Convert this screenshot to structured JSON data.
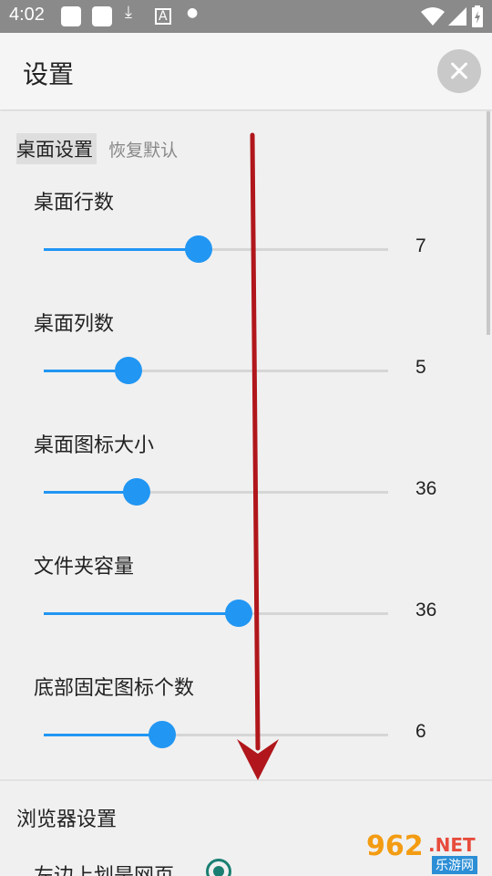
{
  "status_bar": {
    "time": "4:02",
    "icons": [
      "notification-square-icon",
      "notification-square-icon",
      "download-icon",
      "font-icon",
      "dot-icon",
      "wifi-icon",
      "signal-icon",
      "battery-icon"
    ]
  },
  "app_bar": {
    "title": "设置",
    "close_icon": "close-icon"
  },
  "desktop_section": {
    "title": "桌面设置",
    "reset_label": "恢复默认",
    "settings": [
      {
        "label": "桌面行数",
        "value": "7",
        "fraction": 0.45
      },
      {
        "label": "桌面列数",
        "value": "5",
        "fraction": 0.245
      },
      {
        "label": "桌面图标大小",
        "value": "36",
        "fraction": 0.27
      },
      {
        "label": "文件夹容量",
        "value": "36",
        "fraction": 0.565
      },
      {
        "label": "底部固定图标个数",
        "value": "6",
        "fraction": 0.345
      }
    ]
  },
  "browser_section": {
    "title": "浏览器设置",
    "items": [
      {
        "label": "左边上划是网页",
        "selected": true
      }
    ]
  },
  "colors": {
    "accent": "#2196f3",
    "radio": "#1a7f72",
    "annotation_arrow": "#b0161b"
  },
  "watermark": {
    "number": "962",
    "suffix": ".NET",
    "site": "乐游网"
  }
}
